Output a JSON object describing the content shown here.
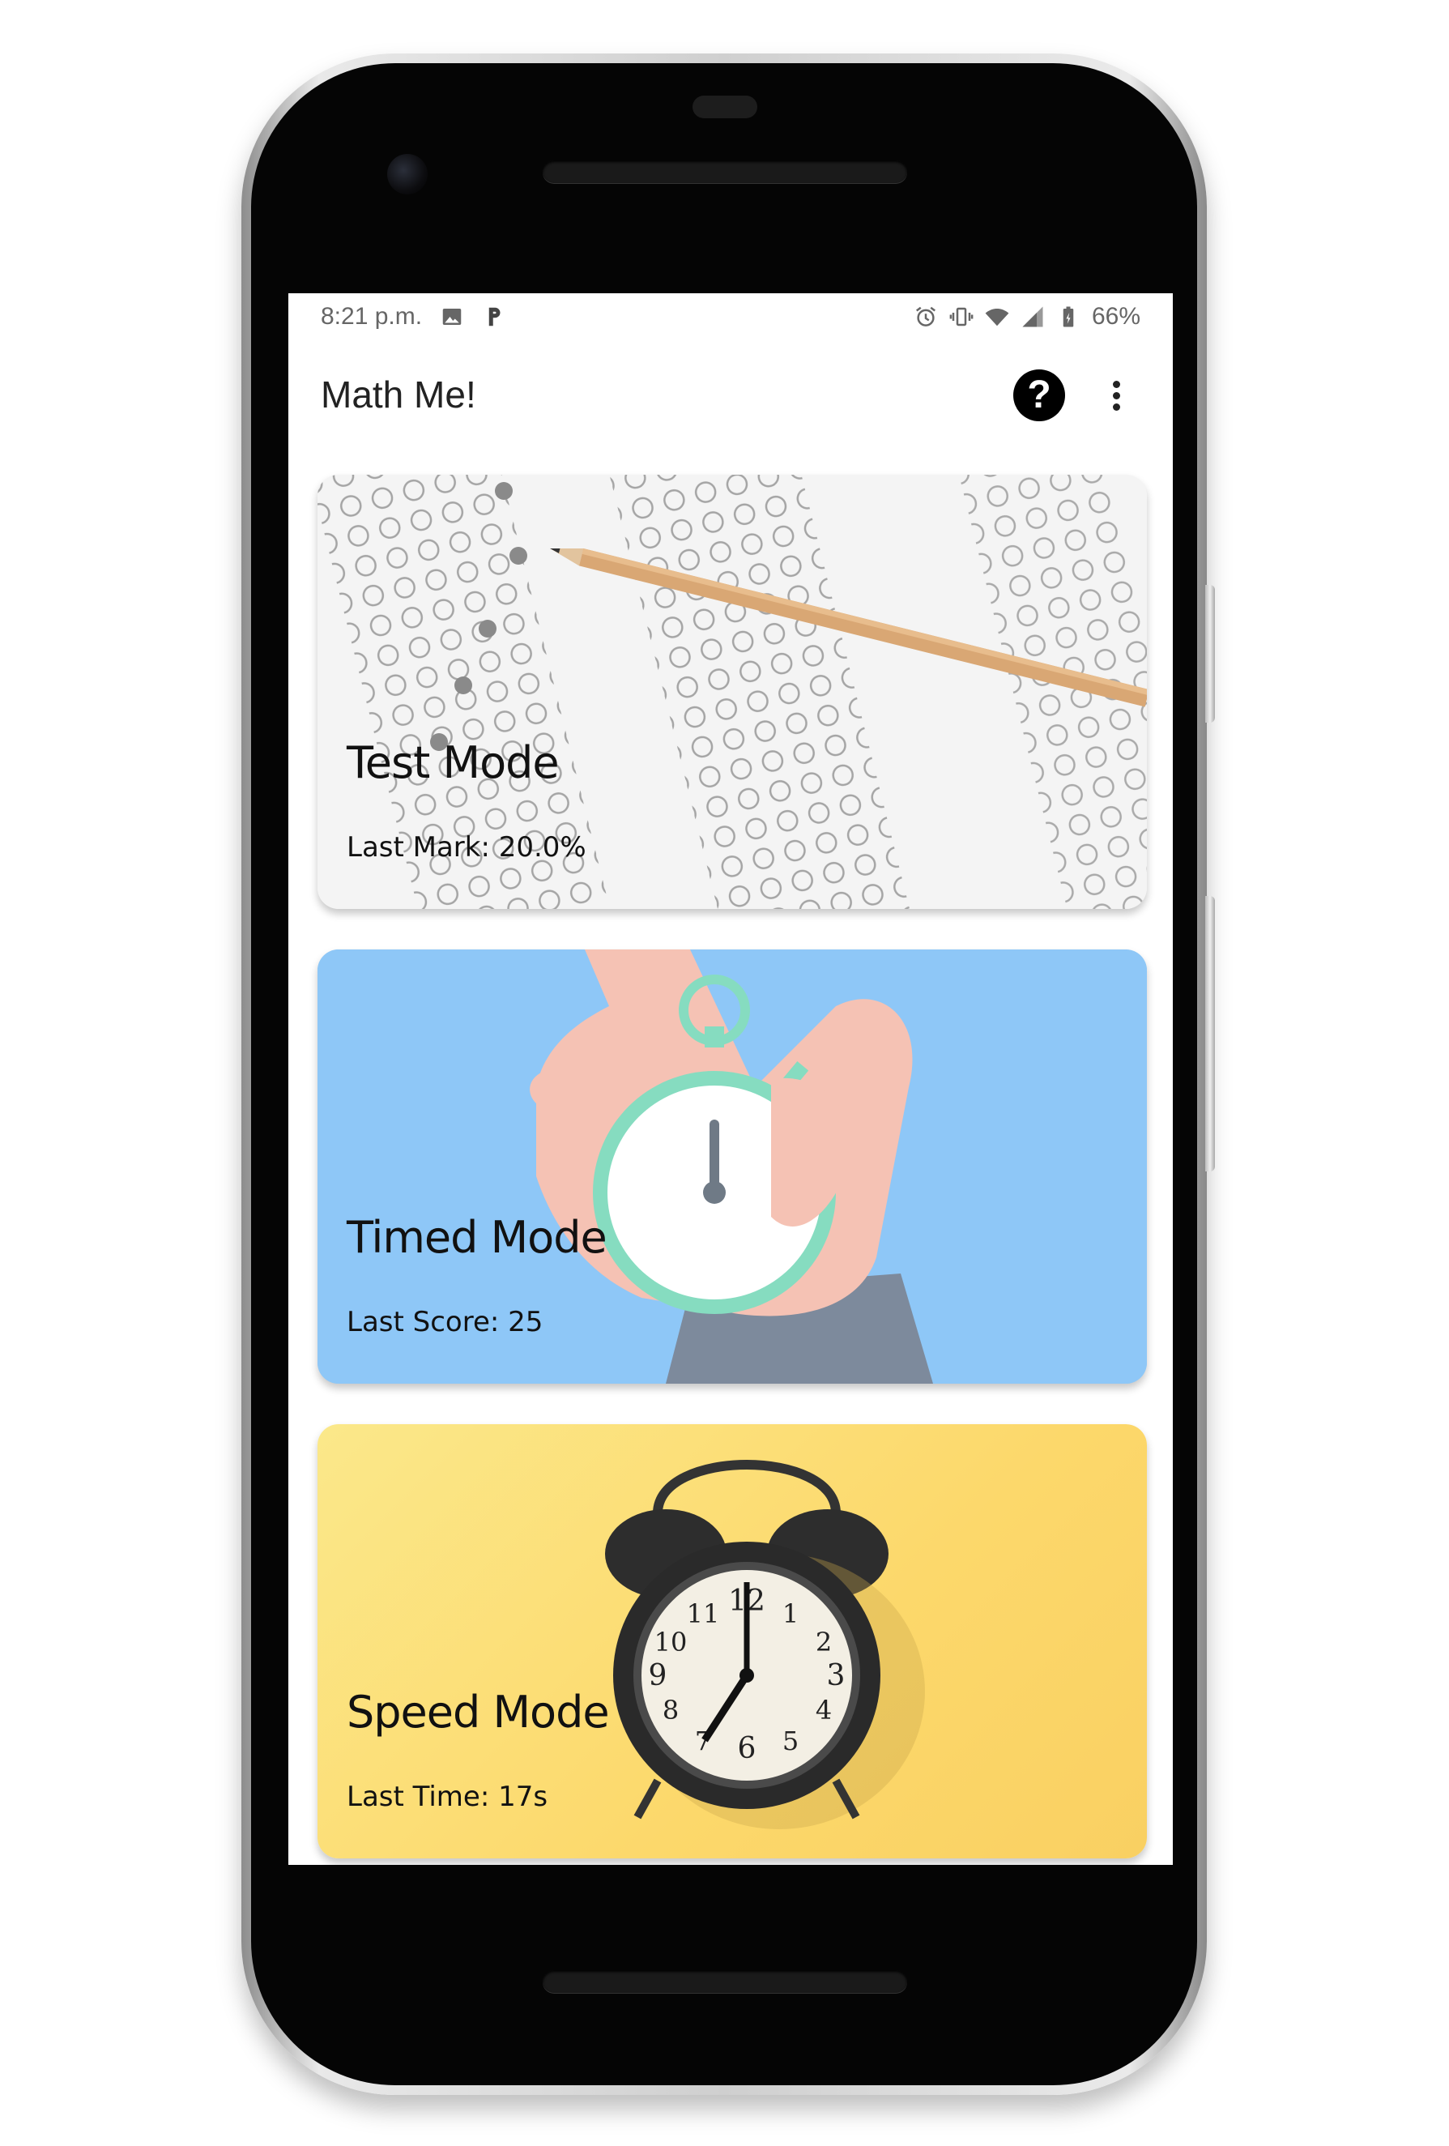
{
  "status_bar": {
    "time": "8:21 p.m.",
    "left_icons": [
      "image-icon",
      "p-app-icon"
    ],
    "right_icons": [
      "alarm-icon",
      "vibrate-icon",
      "wifi-icon",
      "signal-icon",
      "battery-icon"
    ],
    "battery": "66%"
  },
  "app_bar": {
    "title": "Math Me!",
    "help_symbol": "?",
    "actions": [
      "help-icon",
      "more-vert-icon"
    ]
  },
  "cards": [
    {
      "title": "Test Mode",
      "subtitle": "Last Mark: 20.0%",
      "image": "answer-sheet-pencil"
    },
    {
      "title": "Timed Mode",
      "subtitle": "Last Score: 25",
      "image": "hand-stopwatch"
    },
    {
      "title": "Speed Mode",
      "subtitle": "Last Time: 17s",
      "image": "alarm-clock"
    }
  ],
  "colors": {
    "timed_card": "#8ec7f7",
    "speed_card": "#fcd86b",
    "test_card": "#f3f3f3"
  }
}
